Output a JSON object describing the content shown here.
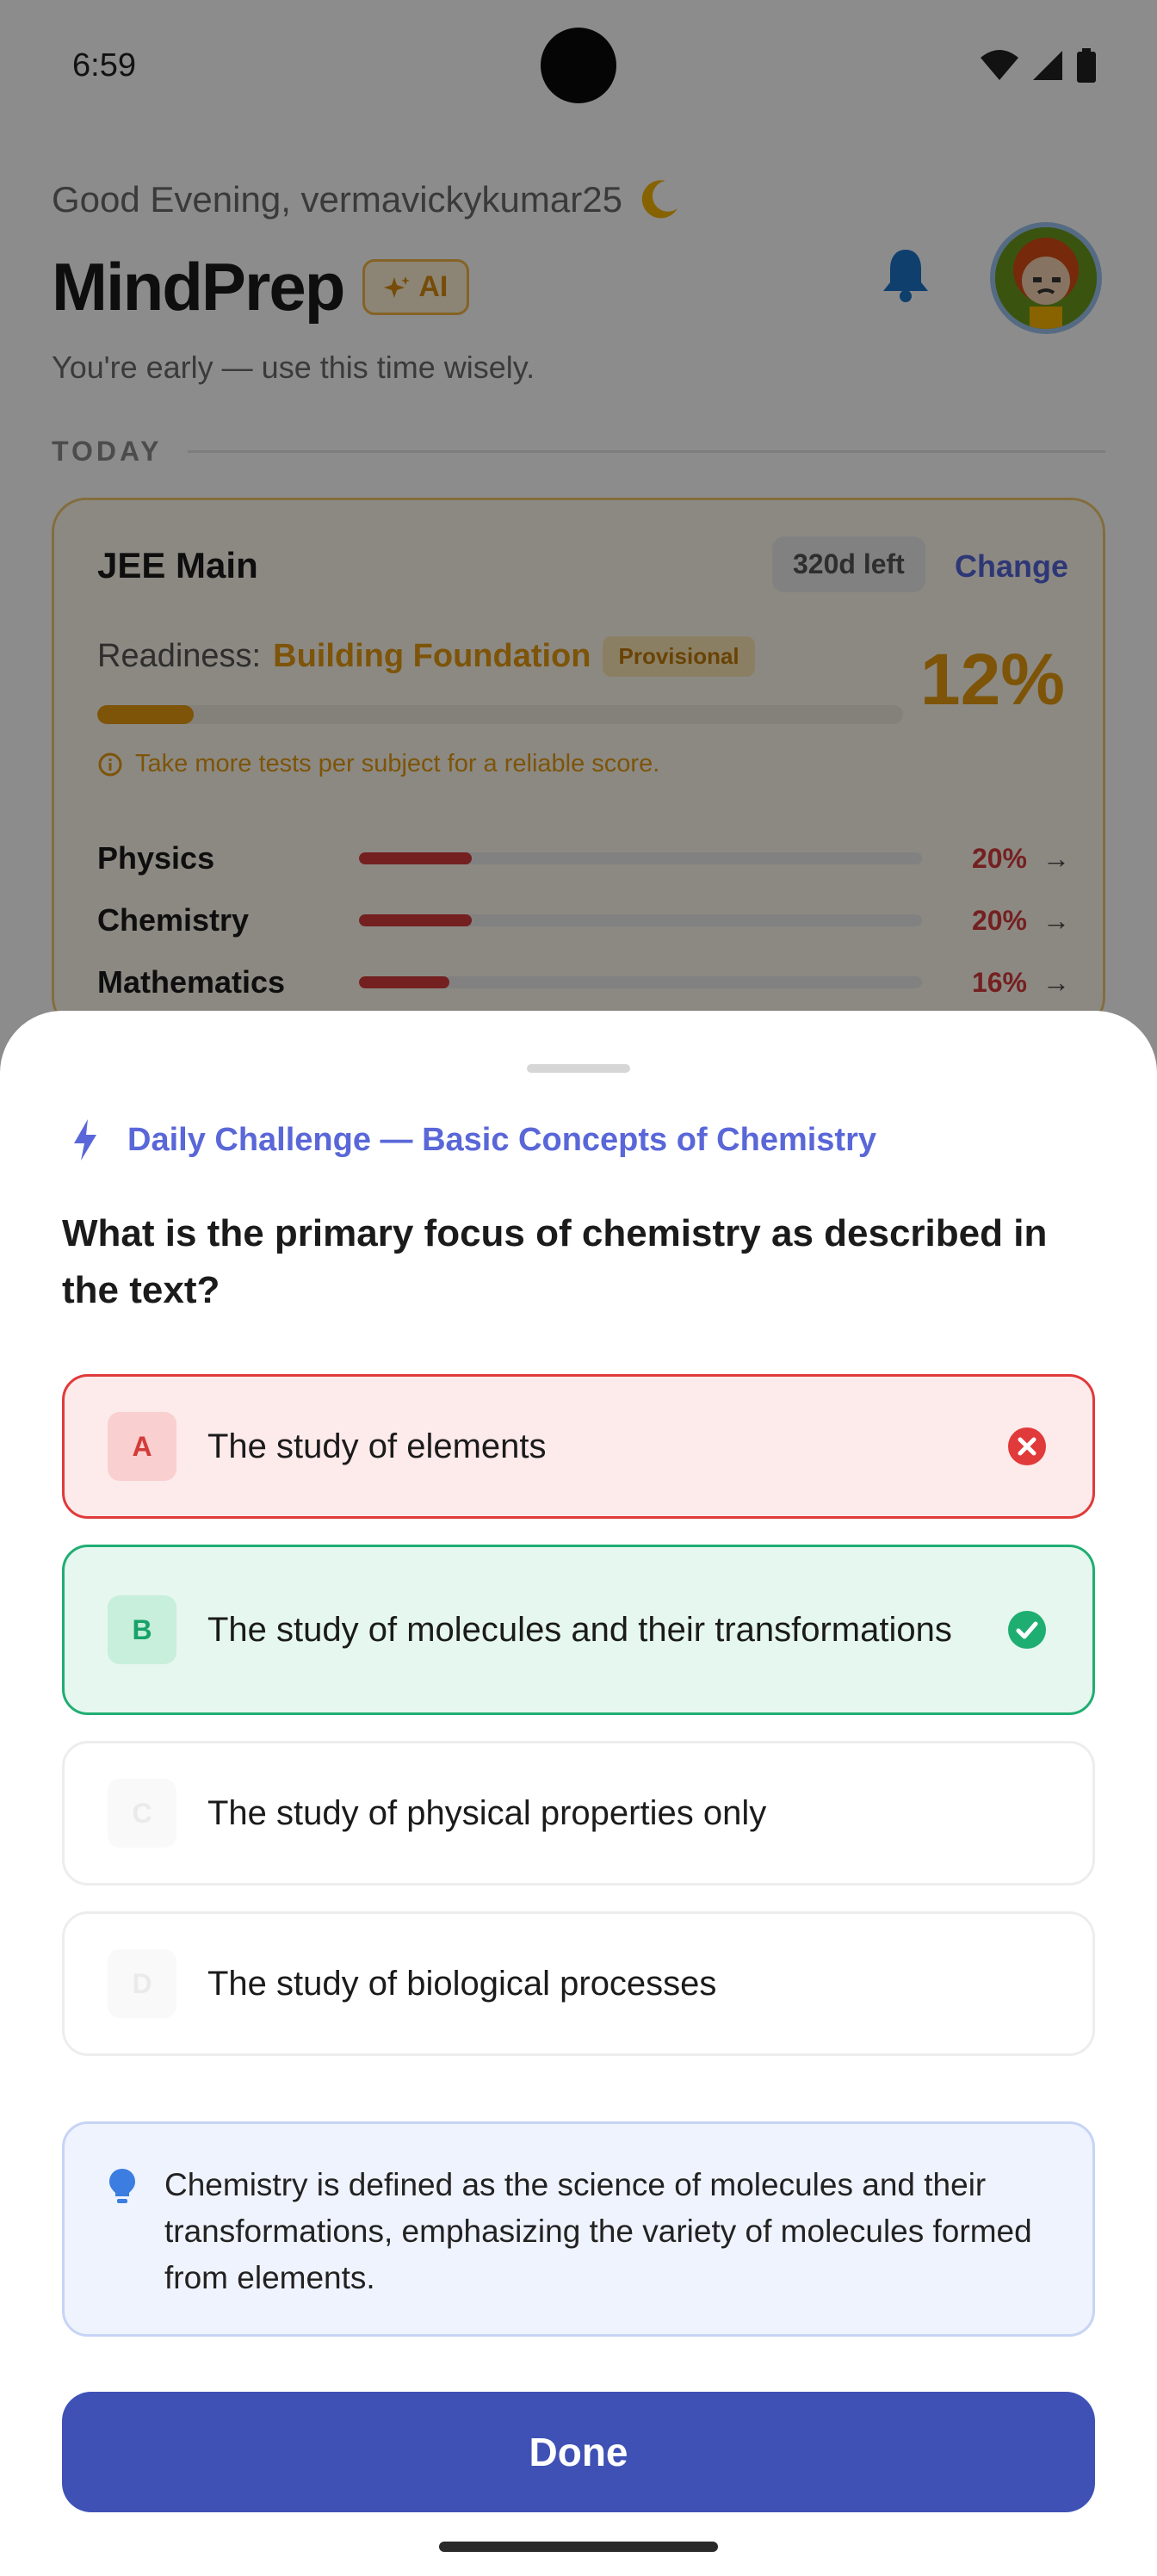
{
  "status_bar": {
    "time": "6:59"
  },
  "header": {
    "greeting": "Good Evening, vermavickykumar25",
    "brand": "MindPrep",
    "ai_badge": "AI",
    "subtitle": "You're early — use this time wisely."
  },
  "section": {
    "today_label": "TODAY"
  },
  "exam_card": {
    "exam_name": "JEE Main",
    "days_left": "320d left",
    "change_label": "Change",
    "readiness_label": "Readiness:",
    "readiness_level": "Building Foundation",
    "provisional_badge": "Provisional",
    "readiness_percent": "12%",
    "readiness_value": 12,
    "hint": "Take more tests per subject for a reliable score.",
    "subjects": [
      {
        "name": "Physics",
        "percent_label": "20%",
        "value": 20,
        "arrow": "→"
      },
      {
        "name": "Chemistry",
        "percent_label": "20%",
        "value": 20,
        "arrow": "→"
      },
      {
        "name": "Mathematics",
        "percent_label": "16%",
        "value": 16,
        "arrow": "→"
      }
    ]
  },
  "daily_challenge": {
    "title": "Daily Challenge — Basic Concepts of Chemistry",
    "question": "What is the primary focus of chemistry as described in the text?",
    "options": [
      {
        "letter": "A",
        "text": "The study of elements",
        "state": "wrong"
      },
      {
        "letter": "B",
        "text": "The study of molecules and their transformations",
        "state": "correct"
      },
      {
        "letter": "C",
        "text": "The study of physical properties only",
        "state": "neutral"
      },
      {
        "letter": "D",
        "text": "The study of biological processes",
        "state": "neutral"
      }
    ],
    "explanation": "Chemistry is defined as the science of molecules and their transformations, emphasizing the variety of molecules formed from elements.",
    "done_label": "Done"
  },
  "colors": {
    "accent": "#3f51b5",
    "challenge_title": "#5a67d8",
    "wrong": "#e03a3a",
    "correct": "#1fae72",
    "readiness": "#e39a10",
    "subject_bar": "#d33b3b"
  }
}
